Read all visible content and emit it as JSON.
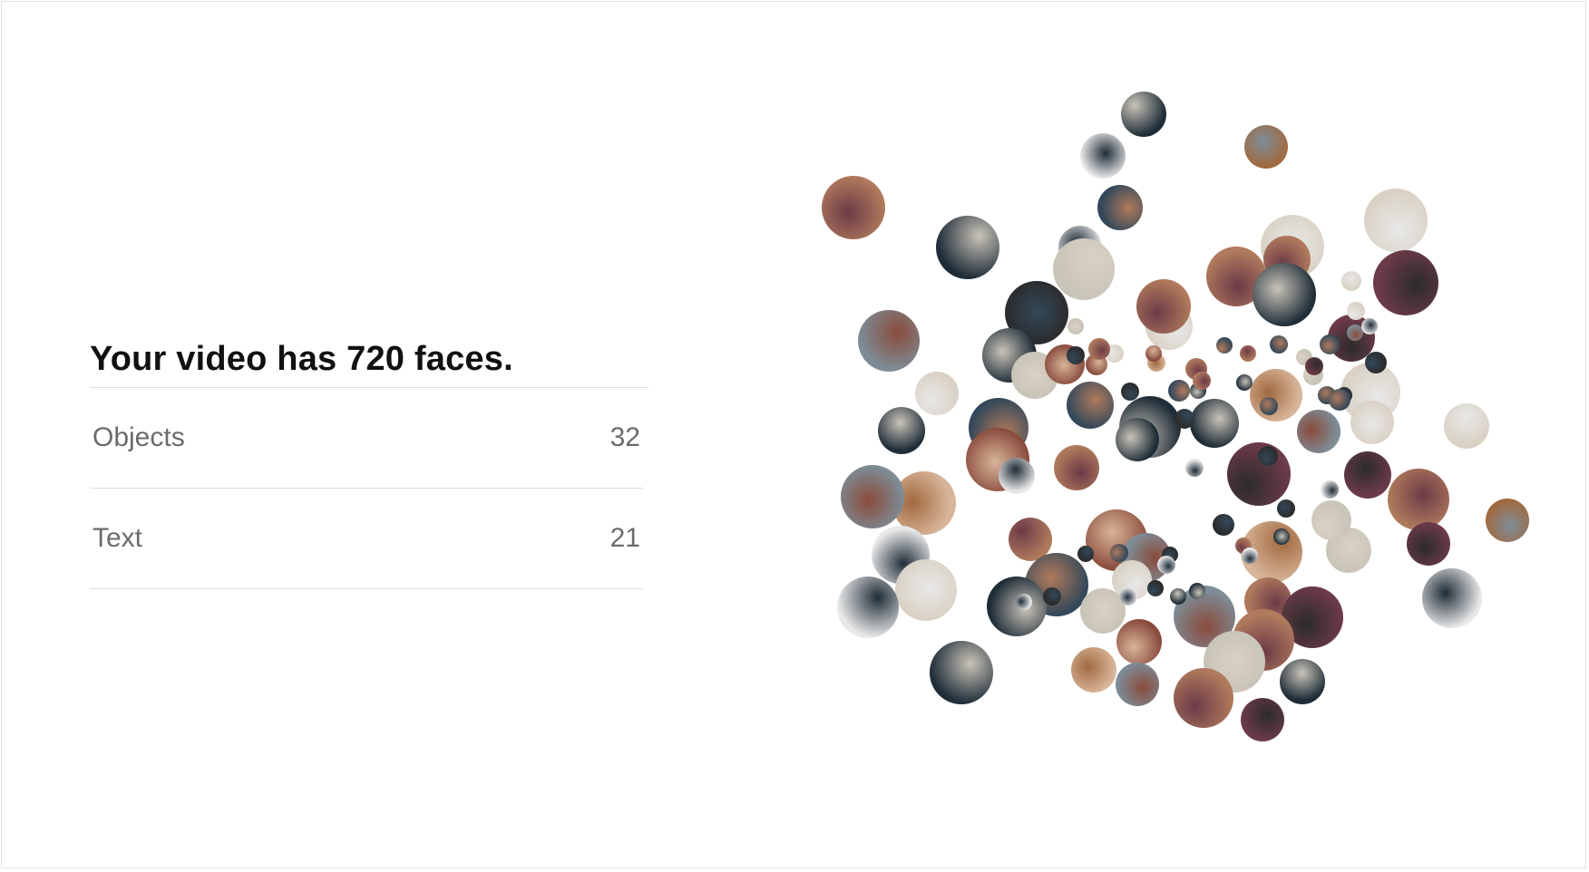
{
  "summary": {
    "headline": "Your video has 720 faces.",
    "rows": [
      {
        "label": "Objects",
        "count": "32"
      },
      {
        "label": "Text",
        "count": "21"
      }
    ]
  },
  "thumbnail_palette": [
    "#1f2d38",
    "#33485a",
    "#7d8d98",
    "#c9c4b8",
    "#b07a5c",
    "#8a4b3c",
    "#d9d1c4",
    "#6c3a48",
    "#d8b59a",
    "#e8e8e8",
    "#2b2b2b",
    "#a1693f"
  ]
}
